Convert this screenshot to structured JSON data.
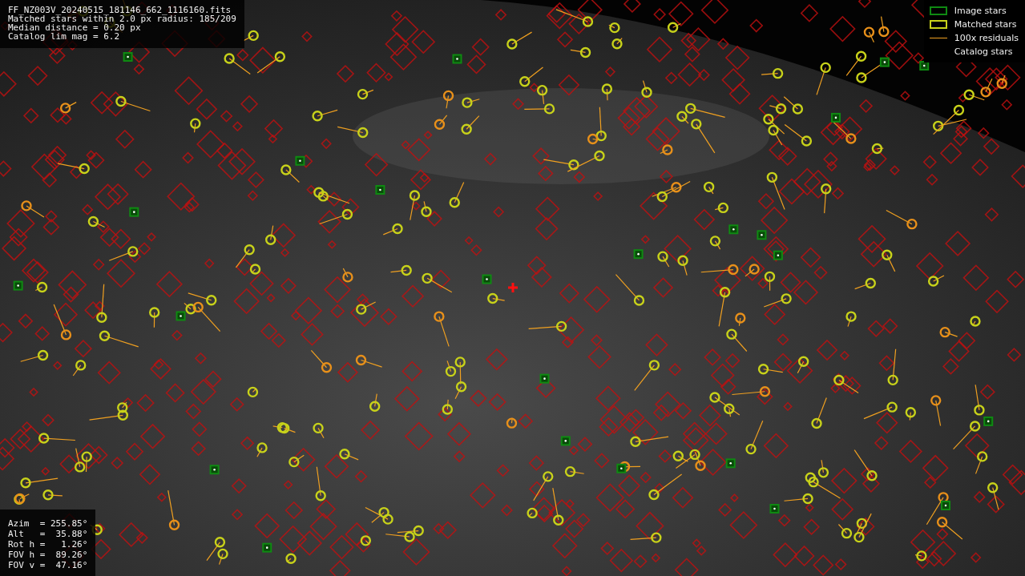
{
  "info_lines": [
    "FF_NZ003V_20240515_181146_662_1116160.fits",
    "Matched stars within 2.0 px radius: 185/209",
    "Median distance = 0.20 px",
    "Catalog lim mag = 6.2"
  ],
  "legend": [
    {
      "kind": "image",
      "label": "Image stars"
    },
    {
      "kind": "matched",
      "label": "Matched stars"
    },
    {
      "kind": "residual",
      "label": "100x residuals"
    },
    {
      "kind": "catalog",
      "label": "Catalog stars"
    }
  ],
  "pointing": [
    "Azim  = 255.85°",
    "Alt   =  35.88°",
    "Rot h =   1.26°",
    "FOV h =  89.26°",
    "FOV v =  47.16°"
  ]
}
